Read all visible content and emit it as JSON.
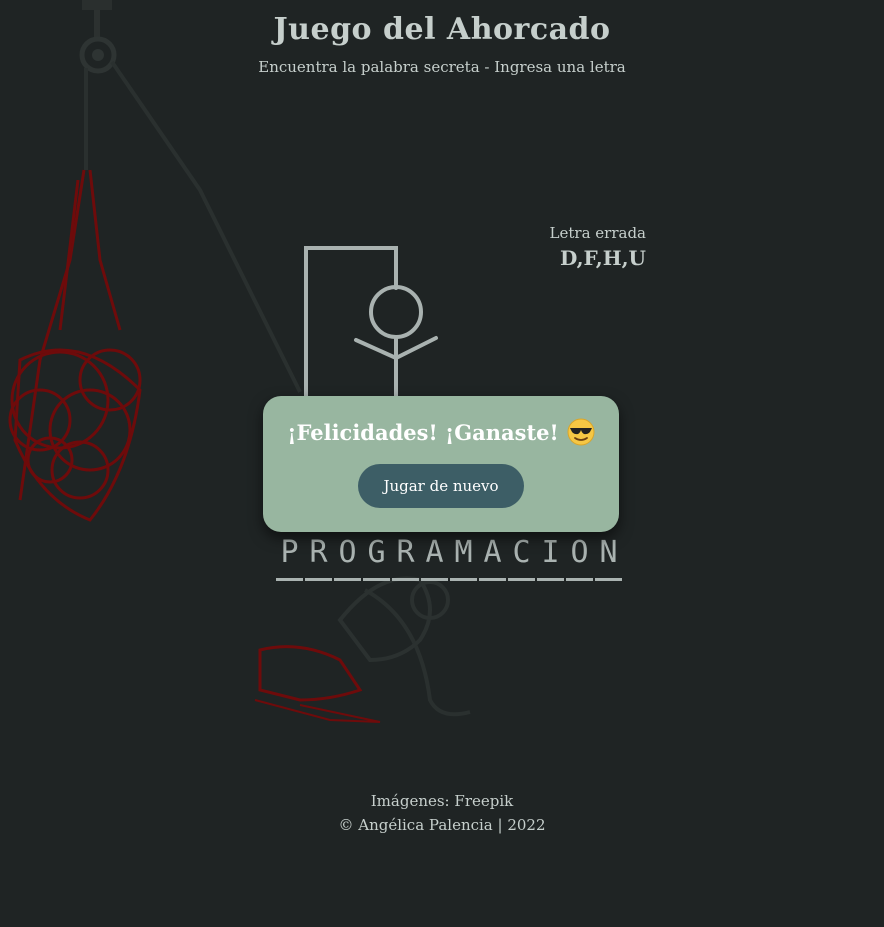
{
  "header": {
    "title": "Juego del Ahorcado",
    "subtitle": "Encuentra la palabra secreta - Ingresa una letra"
  },
  "wrong_letters": {
    "label": "Letra errada",
    "letters": "D,F,H,U"
  },
  "word": {
    "letters": [
      "P",
      "R",
      "O",
      "G",
      "R",
      "A",
      "M",
      "A",
      "C",
      "I",
      "O",
      "N"
    ]
  },
  "modal": {
    "message": "¡Felicidades! ¡Ganaste!",
    "emoji": "smiling-face-with-sunglasses-icon",
    "button_label": "Jugar de nuevo"
  },
  "footer": {
    "credits_label": "Imágenes:",
    "credits_link": "Freepik",
    "copyright": "© Angélica Palencia | 2022"
  },
  "colors": {
    "background": "#1f2424",
    "text": "#c6cfcc",
    "modal_bg": "#98b6a0",
    "button_bg": "#3d5e66",
    "accent_red": "#7a0d0d"
  }
}
